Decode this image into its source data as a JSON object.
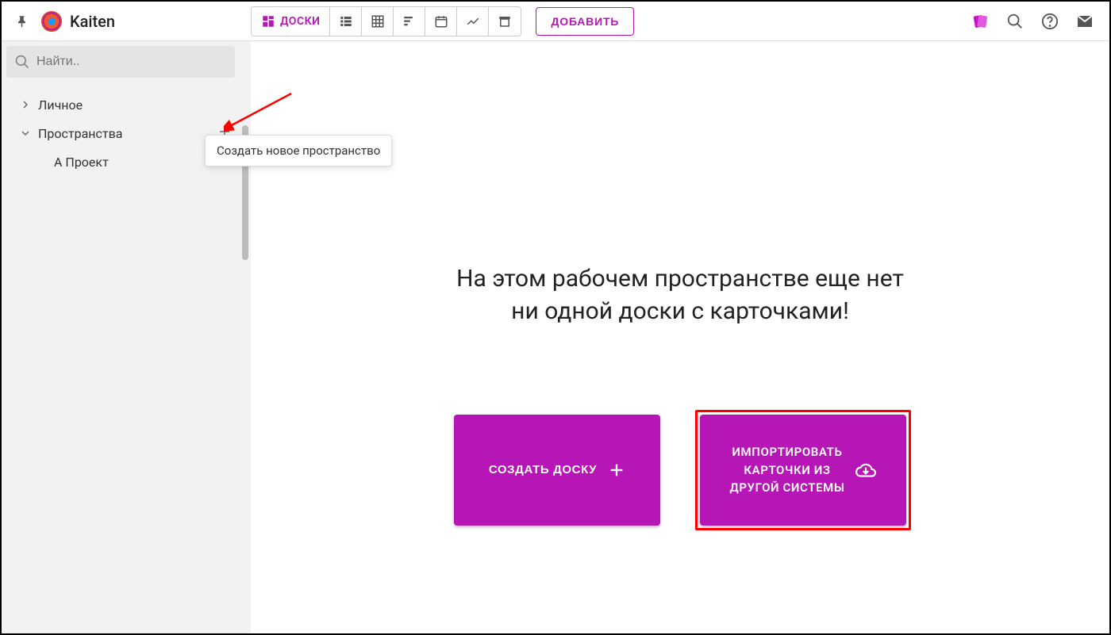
{
  "header": {
    "brand": "Kaiten",
    "views": {
      "boards_label": "ДОСКИ"
    },
    "add_label": "ДОБАВИТЬ"
  },
  "sidebar": {
    "search_placeholder": "Найти..",
    "items": {
      "personal": "Личное",
      "spaces": "Пространства",
      "project_a": "А Проект"
    },
    "tooltip": "Создать новое пространство"
  },
  "main": {
    "empty_line1": "На этом рабочем пространстве еще нет",
    "empty_line2": "ни одной доски с карточками!",
    "create_board": "СОЗДАТЬ ДОСКУ",
    "import_line1": "ИМПОРТИРОВАТЬ",
    "import_line2": "КАРТОЧКИ ИЗ",
    "import_line3": "ДРУГОЙ СИСТЕМЫ"
  },
  "colors": {
    "accent": "#b716b7"
  }
}
